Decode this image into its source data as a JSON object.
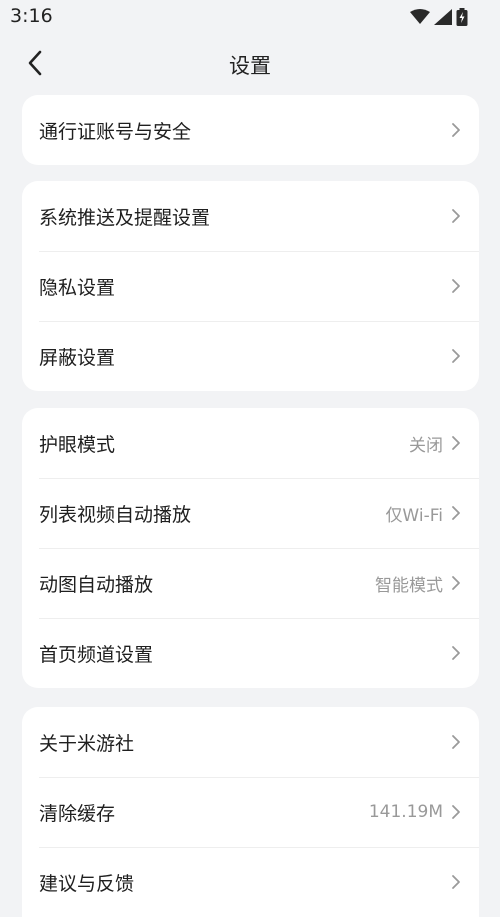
{
  "status_bar": {
    "time": "3:16",
    "icons": [
      "wifi-icon",
      "signal-icon",
      "battery-charging-icon"
    ]
  },
  "nav": {
    "title": "设置",
    "back_icon": "chevron-left-icon"
  },
  "groups": [
    {
      "items": [
        {
          "label": "通行证账号与安全",
          "value": ""
        }
      ]
    },
    {
      "items": [
        {
          "label": "系统推送及提醒设置",
          "value": ""
        },
        {
          "label": "隐私设置",
          "value": ""
        },
        {
          "label": "屏蔽设置",
          "value": ""
        }
      ]
    },
    {
      "items": [
        {
          "label": "护眼模式",
          "value": "关闭"
        },
        {
          "label": "列表视频自动播放",
          "value": "仅Wi-Fi"
        },
        {
          "label": "动图自动播放",
          "value": "智能模式"
        },
        {
          "label": "首页频道设置",
          "value": ""
        }
      ]
    },
    {
      "items": [
        {
          "label": "关于米游社",
          "value": ""
        },
        {
          "label": "清除缓存",
          "value": "141.19M"
        },
        {
          "label": "建议与反馈",
          "value": ""
        }
      ]
    }
  ]
}
